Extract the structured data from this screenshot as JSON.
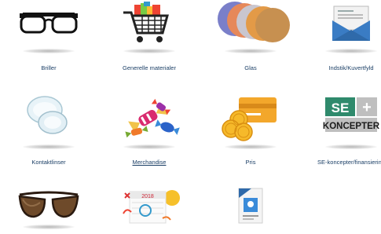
{
  "categories": [
    {
      "label": "Briller",
      "icon": "glasses-icon"
    },
    {
      "label": "Generelle materialer",
      "icon": "shopping-cart-icon"
    },
    {
      "label": "Glas",
      "icon": "lens-samples-icon"
    },
    {
      "label": "Indstik/Kuvertfyld",
      "icon": "envelope-icon"
    },
    {
      "label": "Kontaktlinser",
      "icon": "contact-lens-icon"
    },
    {
      "label": "Merchandise",
      "icon": "candy-icon"
    },
    {
      "label": "Pris",
      "icon": "credit-card-coins-icon"
    },
    {
      "label": "SE-koncepter/finansiering",
      "icon": "se-koncepter-logo-icon"
    },
    {
      "label": "",
      "icon": "sunglasses-icon"
    },
    {
      "label": "",
      "icon": "calendar-icon"
    },
    {
      "label": "",
      "icon": "poster-icon"
    }
  ],
  "logo": {
    "top": "SE",
    "plus": "+",
    "bottom": "KONCEPTER"
  },
  "calendar": {
    "year": "2018"
  },
  "colors": {
    "label": "#1b3f66",
    "envelope": "#3a7cc4",
    "card": "#f3a72b",
    "logo_green": "#2f8a6c"
  }
}
